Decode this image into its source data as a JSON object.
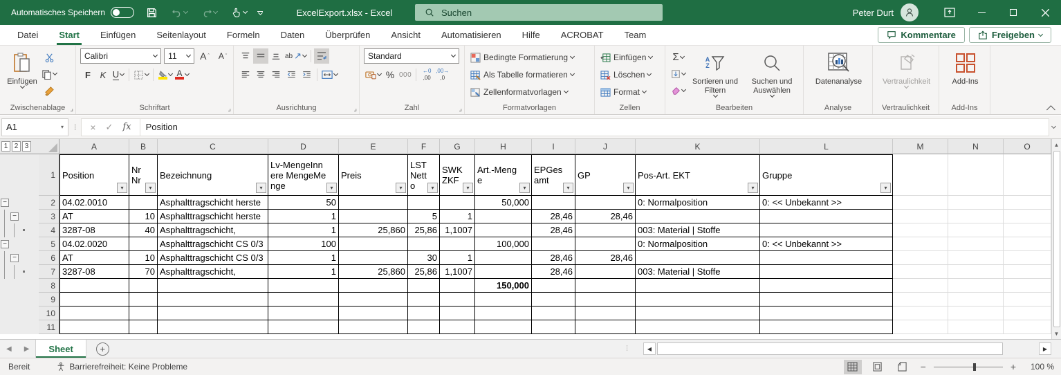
{
  "colors": {
    "titlebar_green": "#1f6e43",
    "accent_green": "#217346",
    "search_bg": "#a3c9b2",
    "addins_orange": "#c8512e",
    "fill_yellow": "#ffe400",
    "font_red": "#e02b1f",
    "icon_blue": "#3b6fb5"
  },
  "titlebar": {
    "autosave_label": "Automatisches Speichern",
    "doc_title": "ExcelExport.xlsx - Excel",
    "search_placeholder": "Suchen",
    "user_name": "Peter Durt"
  },
  "ribbon": {
    "tabs": [
      "Datei",
      "Start",
      "Einfügen",
      "Seitenlayout",
      "Formeln",
      "Daten",
      "Überprüfen",
      "Ansicht",
      "Automatisieren",
      "Hilfe",
      "ACROBAT",
      "Team"
    ],
    "active_tab": "Start",
    "comments_label": "Kommentare",
    "share_label": "Freigeben",
    "groups": {
      "clipboard": {
        "label": "Zwischenablage",
        "paste_label": "Einfügen"
      },
      "font": {
        "label": "Schriftart",
        "font_name": "Calibri",
        "font_size": "11",
        "bold": "F",
        "italic": "K",
        "underline": "U"
      },
      "alignment": {
        "label": "Ausrichtung",
        "orientation_glyph": "ab"
      },
      "number": {
        "label": "Zahl",
        "format": "Standard",
        "percent": "%",
        "thousands": "000",
        "inc_decimal": ",00",
        "dec_decimal": ",0"
      },
      "styles": {
        "label": "Formatvorlagen",
        "items": [
          "Bedingte Formatierung",
          "Als Tabelle formatieren",
          "Zellenformatvorlagen"
        ]
      },
      "cells": {
        "label": "Zellen",
        "items": [
          "Einfügen",
          "Löschen",
          "Format"
        ]
      },
      "editing": {
        "label": "Bearbeiten",
        "sort_label": "Sortieren und Filtern",
        "find_label": "Suchen und Auswählen"
      },
      "analysis": {
        "label": "Analyse",
        "button_label": "Datenanalyse"
      },
      "sensitivity": {
        "label": "Vertraulichkeit",
        "button_label": "Vertraulichkeit"
      },
      "addins": {
        "label": "Add-Ins",
        "button_label": "Add-Ins"
      }
    }
  },
  "formula_bar": {
    "name_box": "A1",
    "fx_label": "fx",
    "value": "Position"
  },
  "sheet": {
    "outline_buttons": [
      "1",
      "2",
      "3"
    ],
    "columns": [
      "A",
      "B",
      "C",
      "D",
      "E",
      "F",
      "G",
      "H",
      "I",
      "J",
      "K",
      "L",
      "M",
      "N",
      "O"
    ],
    "header_cells": [
      "Position",
      "NrNr",
      "Bezeichnung",
      "Lv-MengeInnere MengeMenge",
      "Preis",
      "LSTNetto",
      "SWKZKF",
      "Art.-Menge",
      "EPGesamt",
      "GP",
      "Pos-Art. EKT",
      "Gruppe"
    ],
    "rows": [
      {
        "n": 2,
        "outline": [
          "minus",
          "",
          ""
        ],
        "cells": [
          "04.02.0010",
          "",
          "Asphalttragschicht herste",
          "50",
          "",
          "",
          "",
          "50,000",
          "",
          "",
          "0: Normalposition",
          "0: << Unbekannt >>"
        ]
      },
      {
        "n": 3,
        "outline": [
          "line",
          "minus",
          ""
        ],
        "cells": [
          "AT",
          "10",
          "Asphalttragschicht herste",
          "1",
          "",
          "5",
          "1",
          "",
          "28,46",
          "28,46",
          "",
          ""
        ]
      },
      {
        "n": 4,
        "outline": [
          "line",
          "line",
          "dot"
        ],
        "cells": [
          "3287-08",
          "40",
          "Asphalttragschicht,",
          "1",
          "25,860",
          "25,86",
          "1,1007",
          "",
          "28,46",
          "",
          "003: Material | Stoffe",
          ""
        ]
      },
      {
        "n": 5,
        "outline": [
          "minus",
          "",
          ""
        ],
        "cells": [
          "04.02.0020",
          "",
          "Asphalttragschicht CS 0/3",
          "100",
          "",
          "",
          "",
          "100,000",
          "",
          "",
          "0: Normalposition",
          "0: << Unbekannt >>"
        ]
      },
      {
        "n": 6,
        "outline": [
          "line",
          "minus",
          ""
        ],
        "cells": [
          "AT",
          "10",
          "Asphalttragschicht CS 0/3",
          "1",
          "",
          "30",
          "1",
          "",
          "28,46",
          "28,46",
          "",
          ""
        ]
      },
      {
        "n": 7,
        "outline": [
          "line",
          "line",
          "dot"
        ],
        "cells": [
          "3287-08",
          "70",
          "Asphalttragschicht,",
          "1",
          "25,860",
          "25,86",
          "1,1007",
          "",
          "28,46",
          "",
          "003: Material | Stoffe",
          ""
        ]
      },
      {
        "n": 8,
        "outline": [
          "",
          "",
          ""
        ],
        "cells": [
          "",
          "",
          "",
          "",
          "",
          "",
          "",
          "150,000",
          "",
          "",
          "",
          ""
        ],
        "bold": [
          7
        ]
      },
      {
        "n": 9,
        "outline": [
          "",
          "",
          ""
        ],
        "cells": [
          "",
          "",
          "",
          "",
          "",
          "",
          "",
          "",
          "",
          "",
          "",
          ""
        ]
      },
      {
        "n": 10,
        "outline": [
          "",
          "",
          ""
        ],
        "cells": [
          "",
          "",
          "",
          "",
          "",
          "",
          "",
          "",
          "",
          "",
          "",
          ""
        ]
      },
      {
        "n": 11,
        "outline": [
          "",
          "",
          ""
        ],
        "cells": [
          "",
          "",
          "",
          "",
          "",
          "",
          "",
          "",
          "",
          "",
          "",
          ""
        ]
      }
    ]
  },
  "tab_bar": {
    "active_sheet": "Sheet"
  },
  "status_bar": {
    "ready_label": "Bereit",
    "accessibility_label": "Barrierefreiheit: Keine Probleme",
    "zoom_level": "100 %"
  }
}
